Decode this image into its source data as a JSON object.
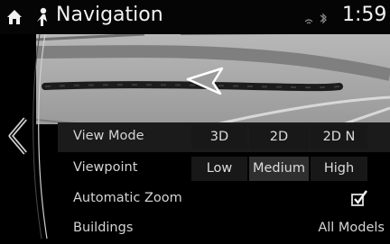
{
  "header": {
    "title": "Navigation",
    "time": "1:59"
  },
  "settings": {
    "view_mode": {
      "label": "View Mode",
      "options": [
        "3D",
        "2D",
        "2D N"
      ],
      "selected": "3D"
    },
    "viewpoint": {
      "label": "Viewpoint",
      "options": [
        "Low",
        "Medium",
        "High"
      ],
      "selected": "Medium"
    },
    "automatic_zoom": {
      "label": "Automatic Zoom",
      "checked": true
    },
    "buildings": {
      "label": "Buildings",
      "value": "All Models"
    }
  }
}
